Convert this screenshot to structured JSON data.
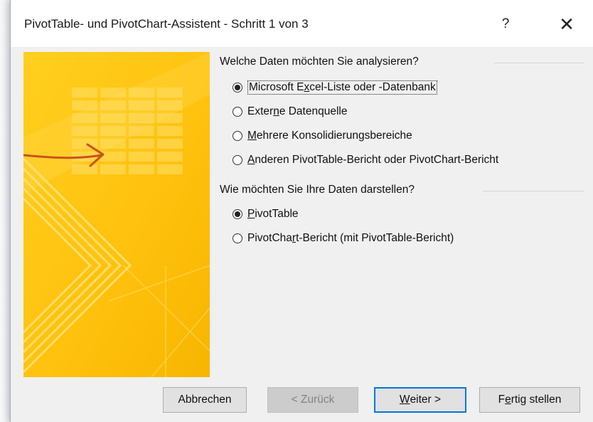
{
  "dialog": {
    "title": "PivotTable- und PivotChart-Assistent - Schritt 1 von 3",
    "help_glyph": "?",
    "close_glyph": "✕"
  },
  "source_group": {
    "label": "Welche Daten möchten Sie analysieren?",
    "options": [
      {
        "pre": "Microsoft E",
        "key": "x",
        "post": "cel-Liste oder -Datenbank",
        "selected": true
      },
      {
        "pre": "Exter",
        "key": "n",
        "post": "e Datenquelle",
        "selected": false
      },
      {
        "pre": "",
        "key": "M",
        "post": "ehrere Konsolidierungsbereiche",
        "selected": false
      },
      {
        "pre": "",
        "key": "A",
        "post": "nderen PivotTable-Bericht oder PivotChart-Bericht",
        "selected": false
      }
    ]
  },
  "report_group": {
    "label": "Wie möchten Sie Ihre Daten darstellen?",
    "options": [
      {
        "pre": "",
        "key": "P",
        "post": "ivotTable",
        "selected": true
      },
      {
        "pre": "PivotCha",
        "key": "r",
        "post": "t-Bericht (mit PivotTable-Bericht)",
        "selected": false
      }
    ]
  },
  "buttons": {
    "cancel": "Abbrechen",
    "back": "< Zurück",
    "next_key": "W",
    "next_rest": "eiter >",
    "finish_pre": "F",
    "finish_key": "e",
    "finish_post": "rtig stellen"
  },
  "colors": {
    "accent": "#0078d7",
    "illustration_yellow": "#ffc20e",
    "arrow": "#c8531e"
  }
}
